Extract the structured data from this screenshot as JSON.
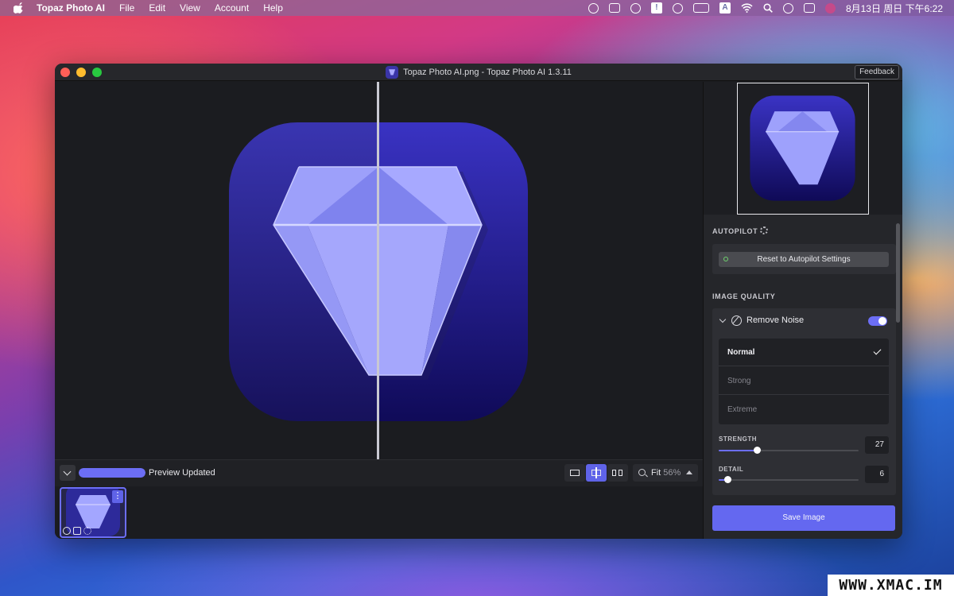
{
  "menubar": {
    "app_name": "Topaz Photo AI",
    "items": [
      "File",
      "Edit",
      "View",
      "Account",
      "Help"
    ],
    "status_icons": [
      "sync-icon",
      "screen-mirror-icon",
      "shield-icon",
      "notice-icon",
      "rocket-icon",
      "battery-icon",
      "input-source-icon",
      "wifi-icon",
      "search-icon",
      "user-icon",
      "control-center-icon",
      "siri-icon"
    ],
    "input_source": "A",
    "notice_glyph": "!",
    "clock": "8月13日 周日 下午6:22"
  },
  "window": {
    "title": "Topaz Photo AI.png - Topaz Photo AI 1.3.11",
    "feedback_label": "Feedback"
  },
  "bottombar": {
    "progress": 1.0,
    "status": "Preview Updated",
    "zoom_label": "Fit",
    "zoom_value": "56%",
    "view_modes": [
      "single-view",
      "split-view",
      "side-by-side-view"
    ],
    "active_view": "split-view"
  },
  "panel": {
    "autopilot_label": "AUTOPILOT",
    "reset_label": "Reset to Autopilot Settings",
    "image_quality_label": "IMAGE QUALITY",
    "remove_noise": {
      "title": "Remove Noise",
      "enabled": true,
      "modes": [
        "Normal",
        "Strong",
        "Extreme"
      ],
      "selected": "Normal"
    },
    "strength": {
      "label": "STRENGTH",
      "value": "27",
      "fraction": 0.27
    },
    "detail": {
      "label": "DETAIL",
      "value": "6",
      "fraction": 0.06
    },
    "save_label": "Save Image"
  },
  "colors": {
    "accent": "#6468f0",
    "panel_bg": "#25262a",
    "canvas_bg": "#1b1c20"
  },
  "watermark": "WWW.XMAC.IM"
}
